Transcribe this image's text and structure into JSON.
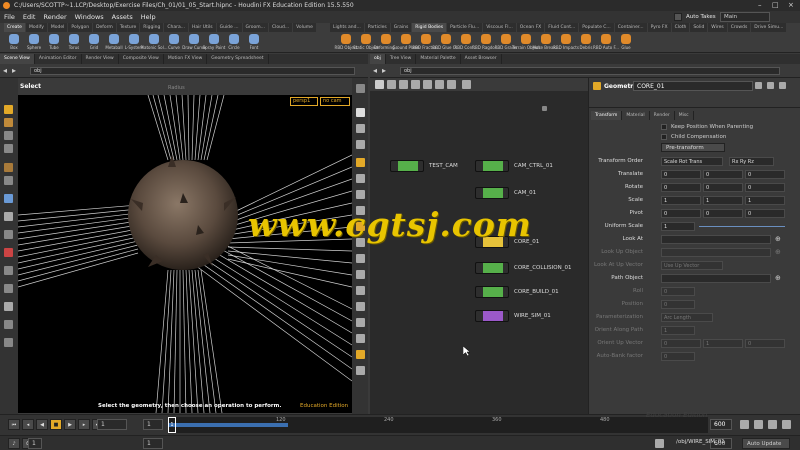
{
  "app": {
    "title": "C:/Users/SCOTTP~1.LCP/Desktop/Exercise Files/Ch_01/01_05_Start.hipnc - Houdini FX Education Edition 15.5.550"
  },
  "menu": [
    "File",
    "Edit",
    "Render",
    "Windows",
    "Assets",
    "Help"
  ],
  "top_right": {
    "auto_takes": "Auto Takes",
    "desktop": "Main"
  },
  "shelf_tabs_left": [
    "Create",
    "Modify",
    "Model",
    "Polygon",
    "Deform",
    "Texture",
    "Rigging",
    "Chara...",
    "Hair Utils",
    "Guide ...",
    "Groom...",
    "Cloud...",
    "Volume"
  ],
  "shelf_tabs_right": [
    "Lights and...",
    "Particles",
    "Grains",
    "Rigid Bodies",
    "Particle Flu...",
    "Viscous Fl...",
    "Ocean FX",
    "Fluid Cont...",
    "Populate C...",
    "Container...",
    "Pyro FX",
    "Cloth",
    "Solid",
    "Wires",
    "Crowds",
    "Drive Simu..."
  ],
  "tools_left": [
    {
      "label": "Box",
      "color": "#7aa3d8"
    },
    {
      "label": "Sphere",
      "color": "#7aa3d8"
    },
    {
      "label": "Tube",
      "color": "#7aa3d8"
    },
    {
      "label": "Torus",
      "color": "#7aa3d8"
    },
    {
      "label": "Grid",
      "color": "#7aa3d8"
    },
    {
      "label": "Metaball",
      "color": "#7aa3d8"
    },
    {
      "label": "L-System",
      "color": "#7aa3d8"
    },
    {
      "label": "Platonic Sol...",
      "color": "#7aa3d8"
    },
    {
      "label": "Curve",
      "color": "#7aa3d8"
    },
    {
      "label": "Draw Curve",
      "color": "#7aa3d8"
    },
    {
      "label": "Spray Paint",
      "color": "#7aa3d8"
    },
    {
      "label": "Circle",
      "color": "#7aa3d8"
    },
    {
      "label": "Font",
      "color": "#7aa3d8"
    }
  ],
  "tools_right": [
    {
      "label": "RBD Object",
      "color": "#e08a2a"
    },
    {
      "label": "Static Object",
      "color": "#e08a2a"
    },
    {
      "label": "Deforming...",
      "color": "#e08a2a"
    },
    {
      "label": "Ground Plane",
      "color": "#e08a2a"
    },
    {
      "label": "RBD Fractur...",
      "color": "#e08a2a"
    },
    {
      "label": "RBD Glue O...",
      "color": "#e08a2a"
    },
    {
      "label": "RBD Cont...",
      "color": "#e08a2a"
    },
    {
      "label": "RBD Ragdol...",
      "color": "#e08a2a"
    },
    {
      "label": "RBD Grains",
      "color": "#e08a2a"
    },
    {
      "label": "Terrain Object",
      "color": "#e08a2a"
    },
    {
      "label": "Make Break...",
      "color": "#e08a2a"
    },
    {
      "label": "RBD Impacts",
      "color": "#e08a2a"
    },
    {
      "label": "Debris",
      "color": "#e08a2a"
    },
    {
      "label": "RBD Auto F...",
      "color": "#e08a2a"
    },
    {
      "label": "Glue",
      "color": "#e08a2a"
    }
  ],
  "left_tabs": [
    "Scene View",
    "Animation Editor",
    "Render View",
    "Composite View",
    "Motion FX View",
    "Geometry Spreadsheet"
  ],
  "right_tabs": [
    "obj",
    "Tree View",
    "Material Palette",
    "Asset Browser"
  ],
  "left_path": "obj",
  "right_path": "obj",
  "viewport": {
    "mode": "Select",
    "radius_label": "Radius",
    "camera": "persp1",
    "cam_menu": "no cam",
    "prompt": "Select the geometry, then choose an operation to perform.",
    "edition": "Education Edition"
  },
  "nodes": [
    {
      "name": "TEST_CAM",
      "color": "#56b04a"
    },
    {
      "name": "CAM_CTRL_01",
      "color": "#56b04a"
    },
    {
      "name": "CAM_01",
      "color": "#56b04a"
    },
    {
      "name": "CORE_01",
      "color": "#e6c23a"
    },
    {
      "name": "CORE_COLLISION_01",
      "color": "#56b04a"
    },
    {
      "name": "CORE_BUILD_01",
      "color": "#56b04a"
    },
    {
      "name": "WIRE_SIM_01",
      "color": "#9b59c9"
    }
  ],
  "params": {
    "header_type": "Geometry",
    "header_name": "CORE_01",
    "tabs": [
      "Transform",
      "Material",
      "Render",
      "Misc"
    ],
    "keep_pos": "Keep Position When Parenting",
    "child_comp": "Child Compensation",
    "pretransform": "Pre-transform",
    "transform_order_label": "Transform Order",
    "transform_order": "Scale Rot Trans",
    "rot_order": "Rx Ry Rz",
    "translate_label": "Translate",
    "translate": [
      "0",
      "0",
      "0"
    ],
    "rotate_label": "Rotate",
    "rotate": [
      "0",
      "0",
      "0"
    ],
    "scale_label": "Scale",
    "scale": [
      "1",
      "1",
      "1"
    ],
    "pivot_label": "Pivot",
    "pivot": [
      "0",
      "0",
      "0"
    ],
    "uniform_label": "Uniform Scale",
    "uniform": "1",
    "lookat_label": "Look At",
    "lookup_label": "Look Up Object",
    "upvec_label": "Look At Up Vector",
    "upvec": "Use Up Vector",
    "pathobj_label": "Path Object",
    "roll_label": "Roll",
    "roll": "0",
    "position_label": "Position",
    "position": "0",
    "param_label": "Parameterization",
    "param": "Arc Length",
    "orient_path_label": "Orient Along Path",
    "orient_path": "1",
    "orient_up_label": "Orient Up Vector",
    "orient_up": [
      "0",
      "1",
      "0"
    ],
    "bank_label": "Auto-Bank factor",
    "bank": "0"
  },
  "timeline": {
    "frame": "1",
    "start": "1",
    "end": "600",
    "end2": "600",
    "ticks": [
      "120",
      "240",
      "360",
      "480"
    ],
    "watermark": "Education Edition"
  },
  "status": {
    "path": "/obj/WIRE_SIM_01",
    "update": "Auto Update"
  },
  "watermark": "www.cgtsj.com"
}
